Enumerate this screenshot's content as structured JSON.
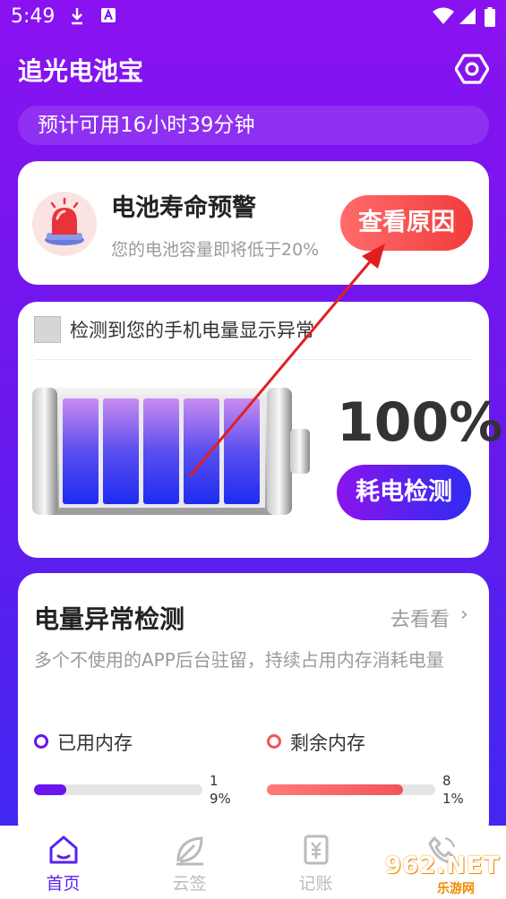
{
  "status_bar": {
    "time": "5:49"
  },
  "header": {
    "title": "追光电池宝"
  },
  "estimate": {
    "text": "预计可用16小时39分钟"
  },
  "warning_card": {
    "title": "电池寿命预警",
    "subtitle": "您的电池容量即将低于20%",
    "button_label": "查看原因"
  },
  "battery_card": {
    "abnormal_text": "检测到您的手机电量显示异常",
    "percent": "100%",
    "level": 1.0,
    "button_label": "耗电检测"
  },
  "memory_card": {
    "title": "电量异常检测",
    "link_label": "去看看",
    "link_chevron": "›",
    "description": "多个不使用的APP后台驻留，持续占用内存消耗电量",
    "used": {
      "label": "已用内存",
      "value": 19,
      "percent_text": "19%",
      "color": "#6a14ee"
    },
    "free": {
      "label": "剩余内存",
      "value": 81,
      "percent_text": "81%",
      "color": "#f2555a"
    }
  },
  "bottom_nav": {
    "items": [
      {
        "label": "首页",
        "icon": "home-icon",
        "active": true
      },
      {
        "label": "云签",
        "icon": "leaf-icon",
        "active": false
      },
      {
        "label": "记账",
        "icon": "ledger-icon",
        "active": false
      },
      {
        "label": "",
        "icon": "phone-icon",
        "active": false
      }
    ]
  },
  "watermark": {
    "text": "962.NET",
    "sub": "乐游网"
  },
  "colors": {
    "accent": "#5a22f0",
    "bg_top": "#8a12f0",
    "bg_bottom": "#3a2af0",
    "warn_red": "#f23c3c",
    "arrow": "#e02020"
  }
}
